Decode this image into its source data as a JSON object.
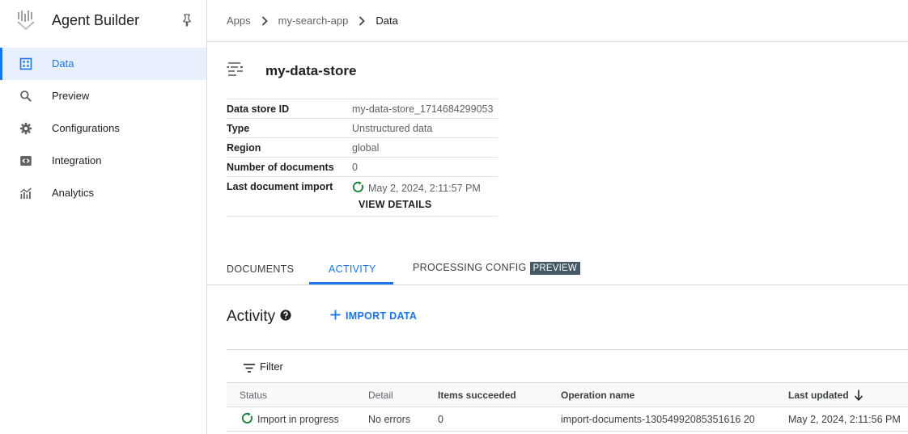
{
  "app": {
    "title": "Agent Builder"
  },
  "sidebar": {
    "items": [
      {
        "label": "Data",
        "icon": "data-grid-icon",
        "active": true
      },
      {
        "label": "Preview",
        "icon": "search-icon"
      },
      {
        "label": "Configurations",
        "icon": "gear-icon"
      },
      {
        "label": "Integration",
        "icon": "code-icon"
      },
      {
        "label": "Analytics",
        "icon": "analytics-icon"
      }
    ]
  },
  "breadcrumb": {
    "items": [
      "Apps",
      "my-search-app",
      "Data"
    ]
  },
  "datastore": {
    "name": "my-data-store",
    "info": [
      {
        "key": "Data store ID",
        "value": "my-data-store_1714684299053"
      },
      {
        "key": "Type",
        "value": "Unstructured data"
      },
      {
        "key": "Region",
        "value": "global"
      },
      {
        "key": "Number of documents",
        "value": "0"
      },
      {
        "key": "Last document import",
        "value": "May 2, 2024, 2:11:57 PM"
      }
    ],
    "view_details": "VIEW DETAILS"
  },
  "tabs": [
    {
      "label": "DOCUMENTS"
    },
    {
      "label": "ACTIVITY",
      "active": true
    },
    {
      "label": "PROCESSING CONFIG",
      "badge": "PREVIEW"
    }
  ],
  "activity": {
    "title": "Activity",
    "import_label": "IMPORT DATA",
    "filter_label": "Filter",
    "columns": [
      "Status",
      "Detail",
      "Items succeeded",
      "Operation name",
      "Last updated"
    ],
    "rows": [
      {
        "status": "Import in progress",
        "detail": "No errors",
        "items_succeeded": "0",
        "operation_name": "import-documents-13054992085351616 20",
        "last_updated": "May 2, 2024, 2:11:56 PM"
      }
    ]
  },
  "colors": {
    "accent": "#1a73e8",
    "success": "#188038",
    "badge_bg": "#455a64"
  }
}
